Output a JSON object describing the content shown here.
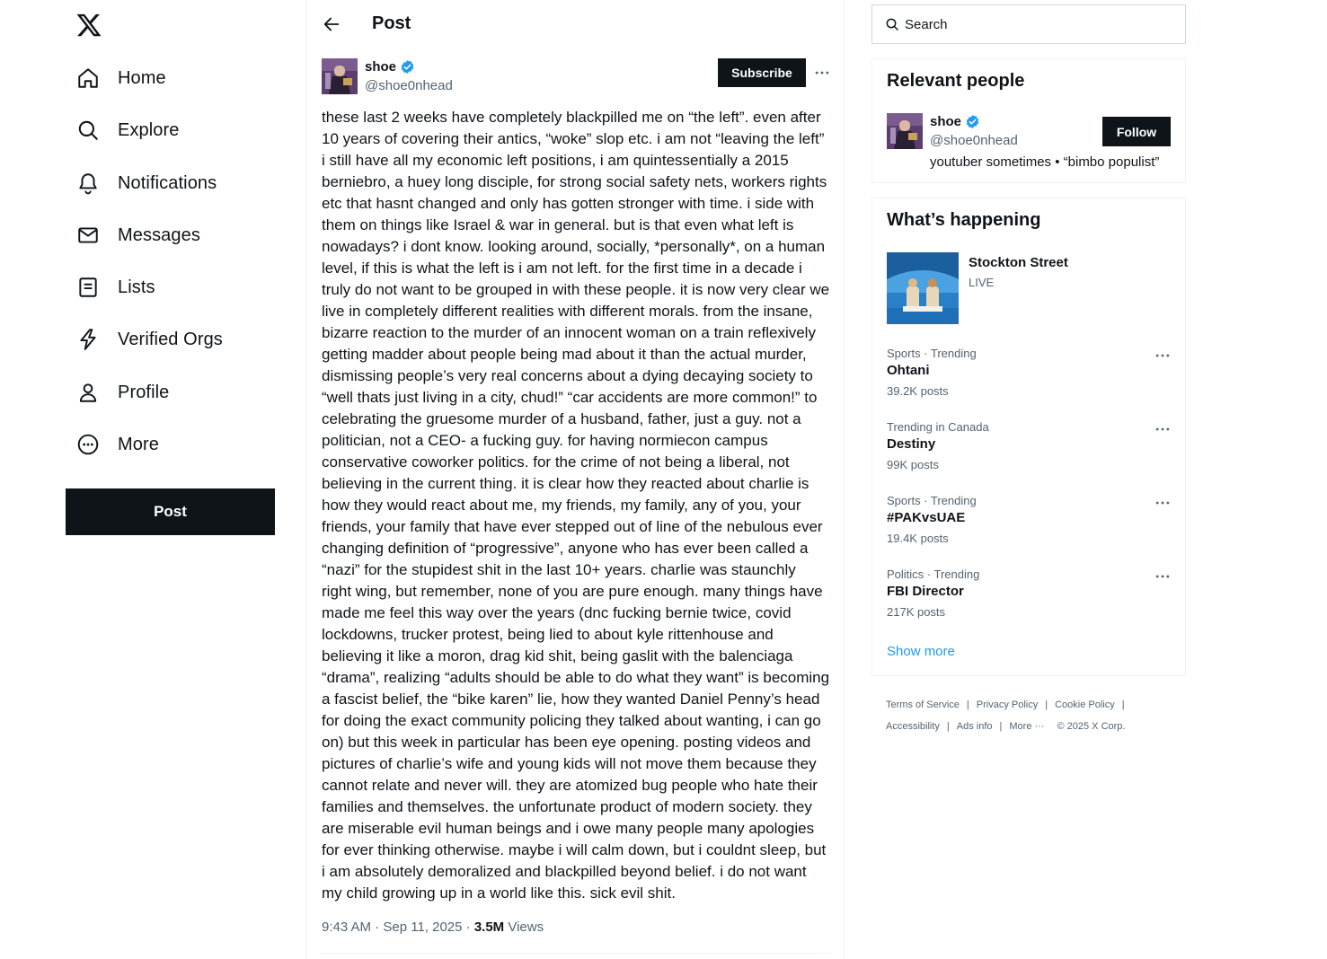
{
  "nav": {
    "logo": "x-logo",
    "items": [
      {
        "label": "Home",
        "icon": "home-icon"
      },
      {
        "label": "Explore",
        "icon": "search-icon"
      },
      {
        "label": "Notifications",
        "icon": "bell-icon"
      },
      {
        "label": "Messages",
        "icon": "envelope-icon"
      },
      {
        "label": "Lists",
        "icon": "list-icon"
      },
      {
        "label": "Verified Orgs",
        "icon": "lightning-icon"
      },
      {
        "label": "Profile",
        "icon": "person-icon"
      },
      {
        "label": "More",
        "icon": "more-circle-icon"
      }
    ],
    "post_button": "Post"
  },
  "header": {
    "title": "Post"
  },
  "post": {
    "author_name": "shoe",
    "author_handle": "@shoe0nhead",
    "subscribe_label": "Subscribe",
    "text": "these last 2 weeks have completely blackpilled me on “the left”. even after\n10 years of covering their antics, “woke” slop etc. i am not “leaving the left”\ni still have all my economic left positions, i am quintessentially a 2015\nberniebro, a huey long disciple, for strong social safety nets, workers rights\netc that hasnt changed and only has gotten stronger with time. i side with\nthem on things like Israel & war in general. but is that even what left is\nnowadays? i dont know. looking around, socially, *personally*, on a human\nlevel, if this is what the left is i am not left. for the first time in a decade i\ntruly do not want to be grouped in with these people. it is now very clear we\nlive in completely different realities with different morals. from the insane,\nbizarre reaction to the murder of an innocent woman on a train reflexively\ngetting madder about people being mad about it than the actual murder,\ndismissing people’s very real concerns about a dying decaying society to\n“well thats just living in a city, chud!” “car accidents are more common!” to\ncelebrating the gruesome murder of a husband, father, just a guy. not a\npolitician, not a CEO- a fucking guy. for having normiecon campus\nconservative coworker politics. for the crime of not being a liberal, not\nbelieving in the current thing. it is clear how they reacted about charlie is\nhow they would react about me, my friends, my family, any of you, your\nfriends, your family that have ever stepped out of line of the nebulous ever\nchanging definition of “progressive”, anyone who has ever been called a\n“nazi” for the stupidest shit in the last 10+ years. charlie was staunchly\nright wing, but remember, none of you are pure enough. many things have\nmade me feel this way over the years (dnc fucking bernie twice, covid\nlockdowns, trucker protest, being lied to about kyle rittenhouse and\nbelieving it like a moron, drag kid shit, being gaslit with the balenciaga\n“drama”, realizing “adults should be able to do what they want” is becoming\na fascist belief, the “bike karen” lie, how they wanted Daniel Penny’s head\nfor doing the exact community policing they talked about wanting, i can go\non) but this week in particular has been eye opening. posting videos and\npictures of charlie’s wife and young kids will not move them because they\ncannot relate and never will. they are atomized bug people who hate their\nfamilies and themselves. the unfortunate product of modern society. they\nare miserable evil human beings and i owe many people many apologies\nfor ever thinking otherwise. maybe i will calm down, but i couldnt sleep, but\ni am absolutely demoralized and blackpilled beyond belief. i do not want\nmy child growing up in a world like this. sick evil shit.",
    "timestamp": "9:43 AM · Sep 11, 2025 · ",
    "views_count": "3.5M",
    "views_label": " Views"
  },
  "search": {
    "placeholder": "Search"
  },
  "relevant_people": {
    "title": "Relevant people",
    "name": "shoe",
    "handle": "@shoe0nhead",
    "bio": "youtuber sometimes • “bimbo populist”",
    "follow_label": "Follow"
  },
  "whats_happening": {
    "title": "What’s happening",
    "live": {
      "title": "Stockton Street",
      "status": "LIVE"
    },
    "trends": [
      {
        "category": "Sports · Trending",
        "name": "Ohtani",
        "count": "39.2K posts"
      },
      {
        "category": "Trending in Canada",
        "name": "Destiny",
        "count": "99K posts"
      },
      {
        "category": "Sports · Trending",
        "name": "#PAKvsUAE",
        "count": "19.4K posts"
      },
      {
        "category": "Politics · Trending",
        "name": "FBI Director",
        "count": "217K posts"
      }
    ],
    "show_more": "Show more"
  },
  "footer": {
    "links": [
      "Terms of Service",
      "Privacy Policy",
      "Cookie Policy",
      "Accessibility",
      "Ads info",
      "More ···"
    ],
    "copyright": "© 2025 X Corp."
  },
  "colors": {
    "accent": "#1d9bf0",
    "text_primary": "#0f1419",
    "text_secondary": "#536471",
    "button_dark": "#0f1419"
  }
}
